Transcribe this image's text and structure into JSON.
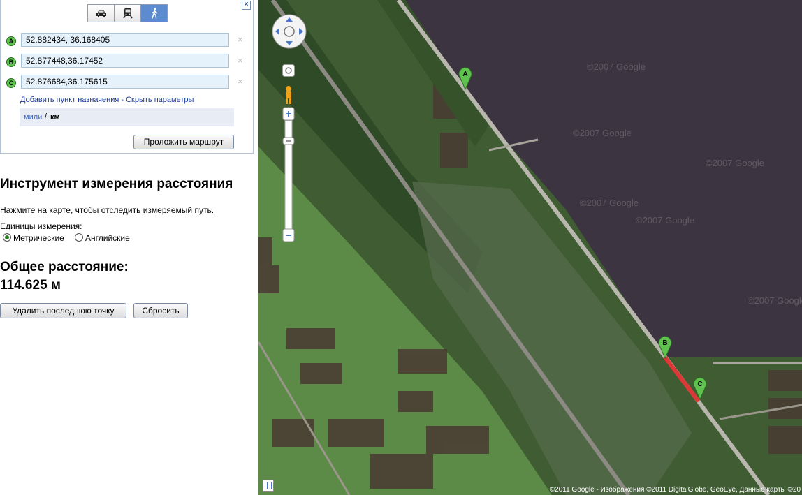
{
  "directions": {
    "close_glyph": "×",
    "modes": [
      {
        "name": "car",
        "icon": "car-icon"
      },
      {
        "name": "transit",
        "icon": "train-icon"
      },
      {
        "name": "walk",
        "icon": "walking-person-icon",
        "selected": true
      }
    ],
    "waypoints": [
      {
        "letter": "A",
        "value": "52.882434, 36.168405"
      },
      {
        "letter": "B",
        "value": "52.877448,36.17452"
      },
      {
        "letter": "C",
        "value": "52.876684,36.175615"
      }
    ],
    "remove_glyph": "×",
    "add_destination": "Добавить пункт назначения",
    "separator": " - ",
    "hide_options": "Скрыть параметры",
    "unit_miles": "мили",
    "unit_slash": "/",
    "unit_km": "км",
    "route_button": "Проложить маршрут"
  },
  "measure_tool": {
    "title": "Инструмент измерения расстояния",
    "hint": "Нажмите на карте, чтобы отследить измеряемый путь.",
    "units_label": "Единицы измерения:",
    "metric": "Метрические",
    "english": "Английские",
    "selected_unit": "metric",
    "total_label": "Общее расстояние:",
    "total_value": "114.625 м",
    "delete_last_button": "Удалить последнюю точку",
    "reset_button": "Сбросить"
  },
  "map": {
    "type": "satellite",
    "markers": [
      "A",
      "B",
      "C"
    ],
    "route_color": "#e22424",
    "marker_color": "#5fc24f",
    "watermark": "©2007 Google",
    "copyright": "©2011 Google - Изображения ©2011 DigitalGlobe, GeoEye, Данные карты ©20"
  }
}
